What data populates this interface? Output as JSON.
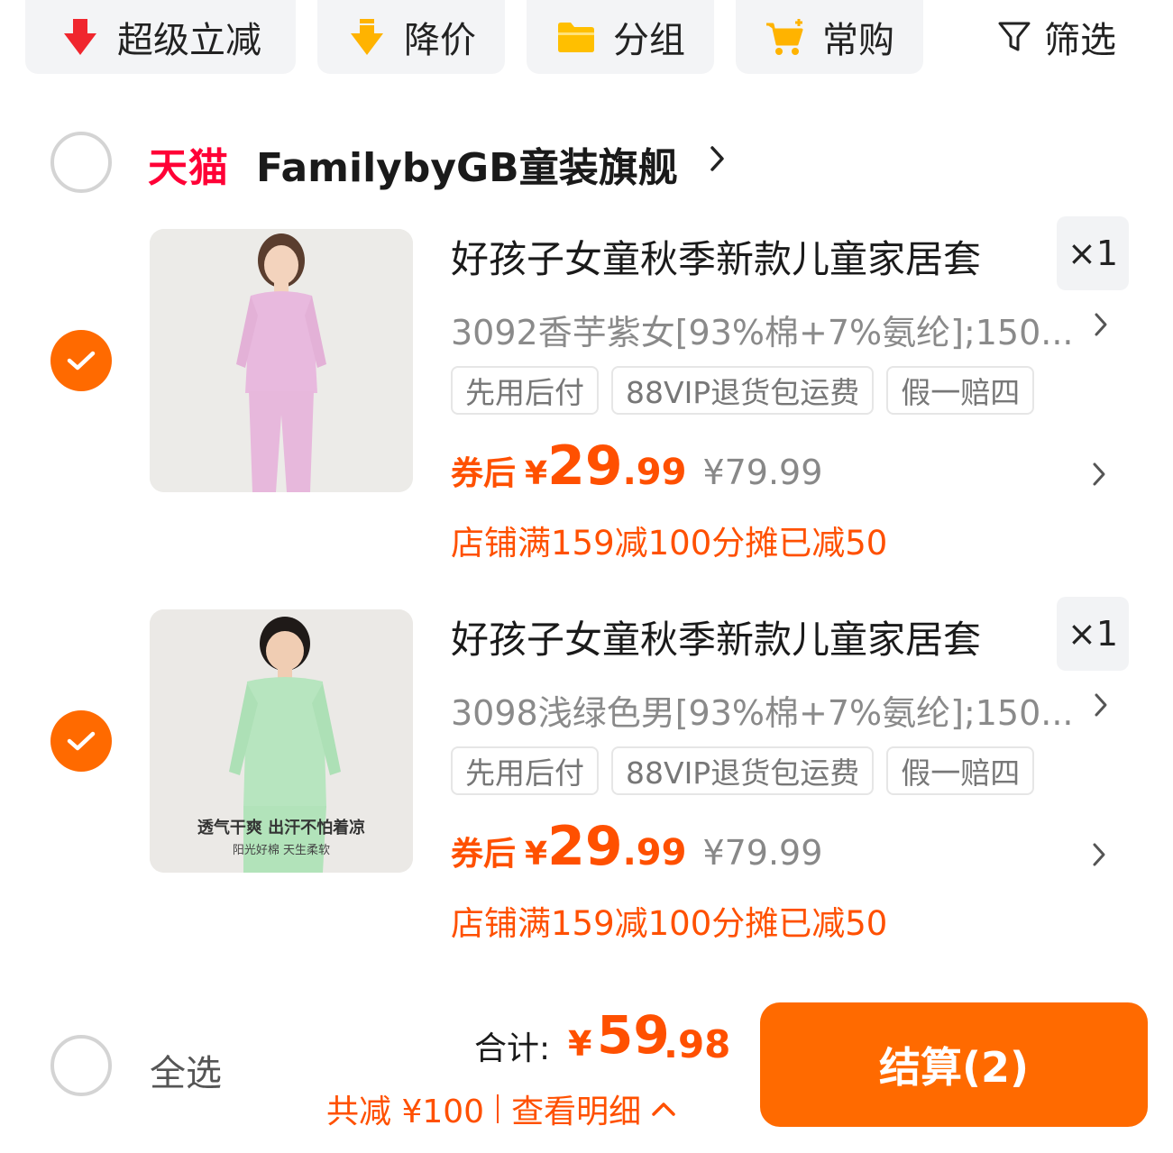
{
  "filters": [
    {
      "label": "超级立减",
      "icon": "red-down-arrow-icon"
    },
    {
      "label": "降价",
      "icon": "yellow-down-arrow-icon"
    },
    {
      "label": "分组",
      "icon": "folder-icon"
    },
    {
      "label": "常购",
      "icon": "cart-icon"
    },
    {
      "label": "筛选",
      "icon": "funnel-icon"
    }
  ],
  "store": {
    "platform": "天猫",
    "name": "FamilybyGB童装旗舰",
    "selected": false
  },
  "items": [
    {
      "selected": true,
      "title": "好孩子女童秋季新款儿童家居套",
      "quantity": "×1",
      "sku": "3092香芋紫女[93%棉+7%氨纶];150...",
      "tags": [
        "先用后付",
        "88VIP退货包运费",
        "假一赔四"
      ],
      "price_label": "券后",
      "price_symbol": "¥",
      "price_int": "29",
      "price_dec": ".99",
      "original_price": "¥79.99",
      "promo": "店铺满159减100分摊已减50",
      "image_color": "#e8b9de"
    },
    {
      "selected": true,
      "title": "好孩子女童秋季新款儿童家居套",
      "quantity": "×1",
      "sku": "3098浅绿色男[93%棉+7%氨纶];150...",
      "tags": [
        "先用后付",
        "88VIP退货包运费",
        "假一赔四"
      ],
      "price_label": "券后",
      "price_symbol": "¥",
      "price_int": "29",
      "price_dec": ".99",
      "original_price": "¥79.99",
      "promo": "店铺满159减100分摊已减50",
      "image_color": "#b7e5bf",
      "image_caption": "透气干爽 出汗不怕着凉",
      "image_subcaption": "阳光好棉  天生柔软"
    }
  ],
  "bottom": {
    "select_all": "全选",
    "total_label": "合计:",
    "total_symbol": "¥",
    "total_int": "59",
    "total_dec": ".98",
    "saved": "共减 ¥100",
    "details": "查看明细",
    "checkout": "结算(2)"
  },
  "colors": {
    "accent": "#ff6a00",
    "price": "#ff5000",
    "tmall": "#ff0036"
  }
}
